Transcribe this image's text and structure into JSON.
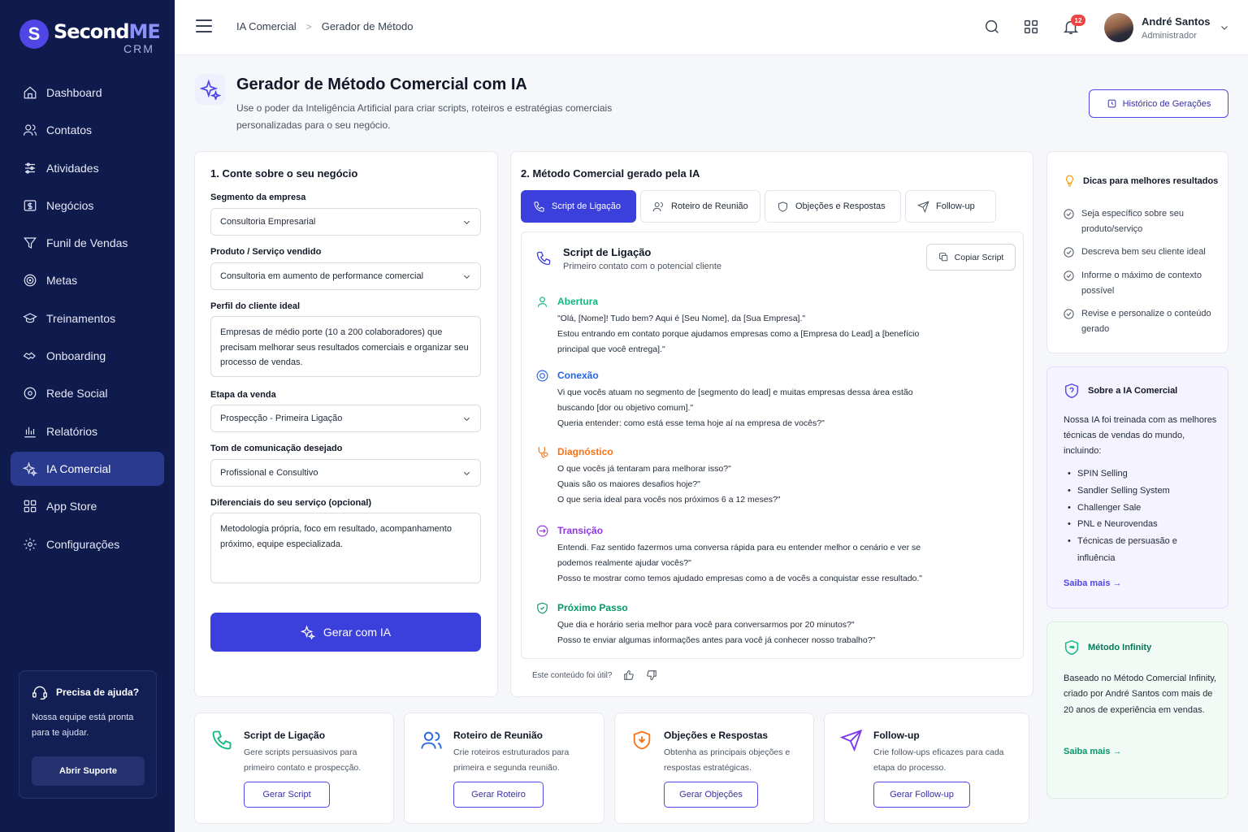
{
  "brand": {
    "name_part1": "Second",
    "name_part2": "ME",
    "sub": "CRM",
    "mark": "S"
  },
  "sidebar": {
    "items": [
      {
        "label": "Dashboard"
      },
      {
        "label": "Contatos"
      },
      {
        "label": "Atividades"
      },
      {
        "label": "Negócios"
      },
      {
        "label": "Funil de Vendas"
      },
      {
        "label": "Metas"
      },
      {
        "label": "Treinamentos"
      },
      {
        "label": "Onboarding"
      },
      {
        "label": "Rede Social"
      },
      {
        "label": "Relatórios"
      },
      {
        "label": "IA Comercial",
        "active": true
      },
      {
        "label": "App Store"
      },
      {
        "label": "Configurações"
      }
    ],
    "help": {
      "title": "Precisa de ajuda?",
      "text": "Nossa equipe está pronta para te ajudar.",
      "button": "Abrir Suporte"
    }
  },
  "header": {
    "breadcrumb": [
      "IA Comercial",
      "Gerador de Método"
    ],
    "notifications_count": "12",
    "user": {
      "name": "André Santos",
      "role": "Administrador"
    }
  },
  "page": {
    "title": "Gerador de Método Comercial com IA",
    "subtitle": "Use o poder da Inteligência Artificial para criar scripts, roteiros e estratégias comerciais personalizadas para o seu negócio.",
    "history_button": "Histórico de Gerações"
  },
  "form": {
    "title": "1. Conte sobre o seu negócio",
    "segment": {
      "label": "Segmento da empresa",
      "value": "Consultoria Empresarial"
    },
    "product": {
      "label": "Produto / Serviço vendido",
      "value": "Consultoria em aumento de performance comercial"
    },
    "profile": {
      "label": "Perfil do cliente ideal",
      "value": "Empresas de médio porte (10 a 200 colaboradores) que precisam melhorar seus resultados comerciais e organizar seu processo de vendas."
    },
    "stage": {
      "label": "Etapa da venda",
      "value": "Prospecção - Primeira Ligação"
    },
    "tone": {
      "label": "Tom de comunicação desejado",
      "value": "Profissional e Consultivo"
    },
    "differentials": {
      "label": "Diferenciais do seu serviço (opcional)",
      "value": "Metodologia própria, foco em resultado, acompanhamento próximo, equipe especializada."
    },
    "generate_button": "Gerar com IA"
  },
  "output": {
    "title": "2. Método Comercial gerado pela IA",
    "tabs": [
      {
        "label": "Script de Ligação",
        "active": true
      },
      {
        "label": "Roteiro de Reunião"
      },
      {
        "label": "Objeções e Respostas"
      },
      {
        "label": "Follow-up"
      }
    ],
    "script": {
      "title": "Script de Ligação",
      "subtitle": "Primeiro contato com o potencial cliente",
      "copy_button": "Copiar Script",
      "steps": [
        {
          "name": "Abertura",
          "color": "#10b981",
          "text": "\"Olá, [Nome]! Tudo bem? Aqui é [Seu Nome], da [Sua Empresa].\"\nEstou entrando em contato porque ajudamos empresas como a [Empresa do Lead] a [benefício\nprincipal que você entrega].\""
        },
        {
          "name": "Conexão",
          "color": "#2563eb",
          "text": "Vi que vocês atuam no segmento de [segmento do lead] e muitas empresas dessa área estão\nbuscando [dor ou objetivo comum].\"\nQueria entender: como está esse tema hoje aí na empresa de vocês?\""
        },
        {
          "name": "Diagnóstico",
          "color": "#f97316",
          "text": "O que vocês já tentaram para melhorar isso?\"\n Quais são os maiores desafios hoje?\"\nO que seria ideal para vocês nos próximos 6 a 12 meses?\""
        },
        {
          "name": "Transição",
          "color": "#9333ea",
          "text": "Entendi. Faz sentido fazermos uma conversa rápida para eu entender melhor o cenário e ver se\npodemos realmente ajudar vocês?\"\nPosso te mostrar como temos ajudado empresas como a de vocês a conquistar esse resultado.\""
        },
        {
          "name": "Próximo Passo",
          "color": "#059669",
          "text": "Que dia e horário seria melhor para você para conversarmos por 20 minutos?\"\nPosso te enviar algumas informações antes para você já conhecer nosso trabalho?\""
        }
      ]
    },
    "feedback": "Este conteúdo foi útil?"
  },
  "tips": {
    "title": "Dicas para melhores resultados",
    "items": [
      "Seja específico sobre seu produto/serviço",
      "Descreva bem seu cliente ideal",
      "Informe o máximo de contexto possível",
      "Revise e personalize o conteúdo gerado"
    ]
  },
  "about": {
    "title": "Sobre a IA Comercial",
    "text": "Nossa IA foi treinada com as melhores técnicas de vendas do mundo, incluindo:",
    "list": [
      "SPIN Selling",
      "Sandler Selling System",
      "Challenger Sale",
      "PNL e Neurovendas",
      "Técnicas de persuasão e influência"
    ],
    "link": "Saiba mais →"
  },
  "infinity": {
    "title": "Método Infinity",
    "text": "Baseado no Método Comercial Infinity, criado por André Santos com mais de 20 anos de experiência em vendas.",
    "link": "Saiba mais →"
  },
  "bottom_cards": [
    {
      "title": "Script de Ligação",
      "desc": "Gere scripts persuasivos para primeiro contato e prospecção.",
      "button": "Gerar Script",
      "icon": "phone-icon",
      "color": "#10b981"
    },
    {
      "title": "Roteiro de Reunião",
      "desc": "Crie roteiros estruturados para primeira e segunda reunião.",
      "button": "Gerar Roteiro",
      "icon": "users-icon",
      "color": "#2563eb"
    },
    {
      "title": "Objeções e Respostas",
      "desc": "Obtenha as principais objeções e respostas estratégicas.",
      "button": "Gerar Objeções",
      "icon": "shield-icon",
      "color": "#f97316"
    },
    {
      "title": "Follow-up",
      "desc": "Crie follow-ups eficazes para cada etapa do processo.",
      "button": "Gerar Follow-up",
      "icon": "send-icon",
      "color": "#7c3aed"
    }
  ]
}
